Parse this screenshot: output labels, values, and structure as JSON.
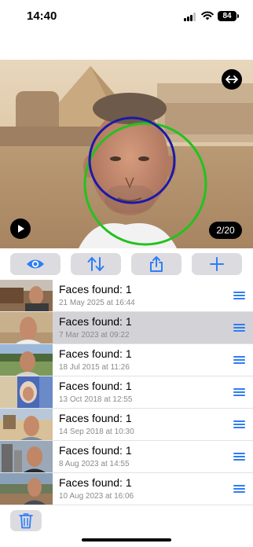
{
  "status_bar": {
    "time": "14:40",
    "battery": "84"
  },
  "photo": {
    "page_indicator": "2/20",
    "icons": {
      "resize": "arrows-left-right-icon",
      "play": "play-icon"
    },
    "colors": {
      "inner_circle": "#1a1aa8",
      "outer_circle": "#22c21e"
    }
  },
  "toolbar": {
    "buttons": [
      {
        "icon": "eye-icon"
      },
      {
        "icon": "sort-arrows-icon"
      },
      {
        "icon": "share-icon"
      },
      {
        "icon": "plus-icon"
      }
    ],
    "accent": "#2f7df6"
  },
  "list": {
    "items": [
      {
        "title": "Faces found: 1",
        "date": "21 May 2025 at 16:44",
        "selected": false
      },
      {
        "title": "Faces found: 1",
        "date": "7 Mar 2023 at 09:22",
        "selected": true
      },
      {
        "title": "Faces found: 1",
        "date": "18 Jul 2015 at 11:26",
        "selected": false
      },
      {
        "title": "Faces found: 1",
        "date": "13 Oct 2018 at 12:55",
        "selected": false
      },
      {
        "title": "Faces found: 1",
        "date": "14 Sep 2018 at 10:30",
        "selected": false
      },
      {
        "title": "Faces found: 1",
        "date": "8 Aug 2023 at 14:55",
        "selected": false
      },
      {
        "title": "Faces found: 1",
        "date": "10 Aug 2023 at 16:06",
        "selected": false
      }
    ]
  },
  "bottom": {
    "trash_icon": "trash-icon"
  }
}
